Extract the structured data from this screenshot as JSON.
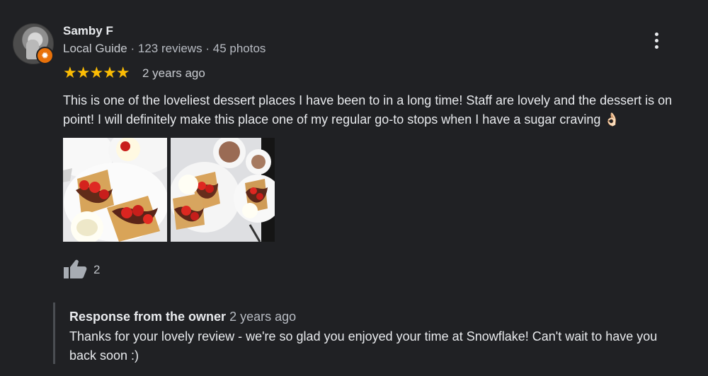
{
  "reviewer": {
    "name": "Samby F",
    "role": "Local Guide",
    "reviews": "123 reviews",
    "photos": "45 photos",
    "separator": "·",
    "badge_icon": "local-guide-star"
  },
  "rating": {
    "stars": "★★★★★",
    "value": 5,
    "time": "2 years ago"
  },
  "review": {
    "text": "This is one of the loveliest dessert places I have been to in a long time! Staff are lovely and the dessert is on point! I will definitely make this place one of my regular go-to stops when I have a sugar craving 👌🏻"
  },
  "photos": [
    {
      "icon": "dessert-photo-waffles"
    },
    {
      "icon": "dessert-photo-drinks"
    }
  ],
  "actions": {
    "like_icon": "thumbs-up-icon",
    "like_count": "2",
    "menu_icon": "more-vert-icon"
  },
  "owner_response": {
    "title": "Response from the owner",
    "time": "2 years ago",
    "text": "Thanks for your lovely review - we're so glad you enjoyed your time at Snowflake! Can't wait to have you back soon :)"
  },
  "colors": {
    "background": "#202124",
    "star": "#fbbc04",
    "badge": "#e8710a"
  }
}
